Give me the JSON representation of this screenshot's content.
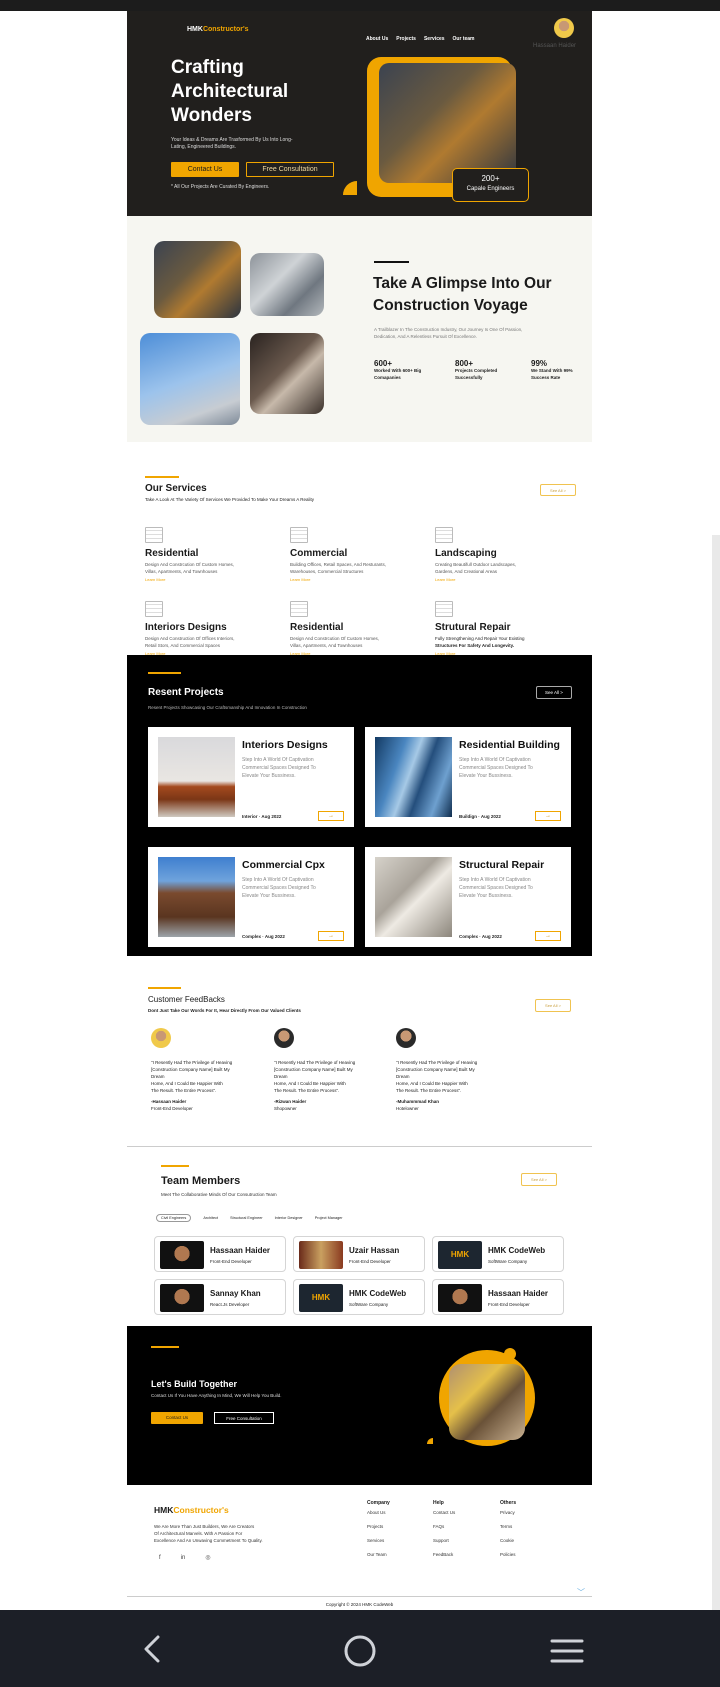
{
  "brand": {
    "logo_a": "HMK",
    "logo_b": "Constructor's"
  },
  "nav": {
    "items": [
      "About Us",
      "Projects",
      "Services",
      "Our team"
    ],
    "user_name": "Hassaan Haider"
  },
  "hero": {
    "title_1": "Crafting",
    "title_2": "Architectural",
    "title_3": "Wonders",
    "desc_1": "Your Ideas & Dreams Are Trasformed By Us Into Long-",
    "desc_2": "Lating, Engineered Buildings.",
    "contact_btn": "Contact Us",
    "consult_btn": "Free Consultation",
    "note": "* All Our Projects Are Curated By Engineers.",
    "badge_num": "200+",
    "badge_label": "Capale Engineers"
  },
  "glimpse": {
    "title_1": "Take A Glimpse Into Our",
    "title_2": "Construction Voyage",
    "desc_1": "A Trailblazer In The Construction Industry, Our Journey Is One Of Passion,",
    "desc_2": "Dedication, And A Relentless Pursuit Of Excellence.",
    "stats": [
      {
        "num": "600+",
        "l1": "Worked With 600+ Big",
        "l2": "Comapanies"
      },
      {
        "num": "800+",
        "l1": "Projects Completed",
        "l2": "Successfully"
      },
      {
        "num": "99%",
        "l1": "We Stand With 99%",
        "l2": "Success Rate"
      }
    ]
  },
  "services": {
    "title": "Our Services",
    "subtitle": "Take A Look At The Variety Of Services We Provided To Make Your Dreams A Reality",
    "see_all": "See All >",
    "items": [
      {
        "title": "Residential",
        "d1": "Design And Constrcution Of Custom Homes,",
        "d2": "Villas, Apartments, And Townhouses",
        "link": "Learn More"
      },
      {
        "title": "Commercial",
        "d1": "Building Offices, Retail Spaces, And Resturants,",
        "d2": "Warehouses, Commercial Structures",
        "link": "Learn More"
      },
      {
        "title": "Landscaping",
        "d1": "Creating Beautifull Outdoor Landscapes,",
        "d2": "Gardens, And Creational Areas",
        "link": "Learn More"
      },
      {
        "title": "Interiors Designs",
        "d1": "Design And Construction Of Offices Interiors,",
        "d2": "Retail Stors, And Commercial Spaces",
        "link": "Learn More"
      },
      {
        "title": "Residential",
        "d1": "Design And Constrcution Of Custom Homes,",
        "d2": "Villas, Apartments, And Townhouses",
        "link": "Learn More"
      },
      {
        "title": "Strutural Repair",
        "d1": "Fully Strengthening And Repair Your Existing",
        "d2": "Structures For Safety And Longevity.",
        "link": "Learn More"
      }
    ]
  },
  "projects": {
    "title": "Resent Projects",
    "subtitle": "Resent Projects Showcasing Our Craftsmanship And Innovation In Construction",
    "see_all": "See All >",
    "desc_1": "Step Into A World Of Captivation",
    "desc_2": "Commercial Spaces Designed To",
    "desc_3": "Elevate Your Bussiness.",
    "items": [
      {
        "title": "Interiors Designs",
        "tag": "Interior",
        "date": "Aug 2022"
      },
      {
        "title": "Residential Building",
        "tag": "Buildign",
        "date": "Aug 2022"
      },
      {
        "title": "Commercial Cpx",
        "tag": "Complex",
        "date": "Aug 2022"
      },
      {
        "title": "Structural Repair",
        "tag": "Complex",
        "date": "Aug 2022"
      }
    ]
  },
  "feedback": {
    "title": "Customer FeedBacks",
    "subtitle": "Dont Just Take Our Words For It, Hear Directly From Our Valued Clients",
    "see_all": "See All >",
    "q1": "\"I Resently Had The Privilege of Heaving",
    "q2": "[Construction Company Name] Built My",
    "q3": "Dream",
    "q4": "Home, And I Could Be Happier With",
    "q5": "The Result. The Entire Process\".",
    "items": [
      {
        "name": "-Hassaan Haider",
        "role": "Front-End Developer"
      },
      {
        "name": "-Rizwan Haider",
        "role": "Shopowner"
      },
      {
        "name": "-Muhammmad Khan",
        "role": "Hotelowner"
      }
    ]
  },
  "team": {
    "title": "Team Members",
    "subtitle": "Meet The Collaborative Minds Of Our Consutruction Team",
    "see_all": "See All >",
    "tabs": [
      "Civil Engineers",
      "Architect",
      "Structural Engineer",
      "Interior Designer",
      "Project Manager"
    ],
    "members": [
      {
        "name": "Hassaan Haider",
        "role": "Front-End Developer"
      },
      {
        "name": "Uzair Hassan",
        "role": "Front-End Developer"
      },
      {
        "name": "HMK CodeWeb",
        "role": "SoftWare Company"
      },
      {
        "name": "Sannay Khan",
        "role": "React.Js Developer"
      },
      {
        "name": "HMK CodeWeb",
        "role": "SoftWare Company"
      },
      {
        "name": "Hassaan Haider",
        "role": "Front-End Developer"
      }
    ],
    "logo_text": "HMK"
  },
  "cta": {
    "title": "Let's Build Together",
    "subtitle": "Contact Us If You Have Anything In Mind, We Will Help You Build.",
    "contact_btn": "Contact Us",
    "consult_btn": "Free Consultation"
  },
  "footer": {
    "about_1": "We Are More Than Just Builders, We Are Creators",
    "about_2": "Of Architectural Marvels. With A Passion For",
    "about_3": "Excellence And An Unwaving Commetment To Quality.",
    "social": [
      "f",
      "in",
      "◎"
    ],
    "cols": [
      {
        "title": "Company",
        "links": [
          "About Us",
          "Projects",
          "Services",
          "Our Team"
        ]
      },
      {
        "title": "Help",
        "links": [
          "Contact Us",
          "FAQs",
          "Support",
          "FeedBack"
        ]
      },
      {
        "title": "Others",
        "links": [
          "Privacy",
          "Terms",
          "Cookie",
          "Policies"
        ]
      }
    ],
    "copyright": "Copyright © 2024 HMK CodeWeb"
  },
  "system_nav": {
    "back": "back-icon",
    "home": "home-icon",
    "menu": "menu-icon"
  },
  "colors": {
    "accent": "#f0a500",
    "dark": "#211f1d",
    "black": "#000000",
    "light_bg": "#f6f6f1"
  }
}
